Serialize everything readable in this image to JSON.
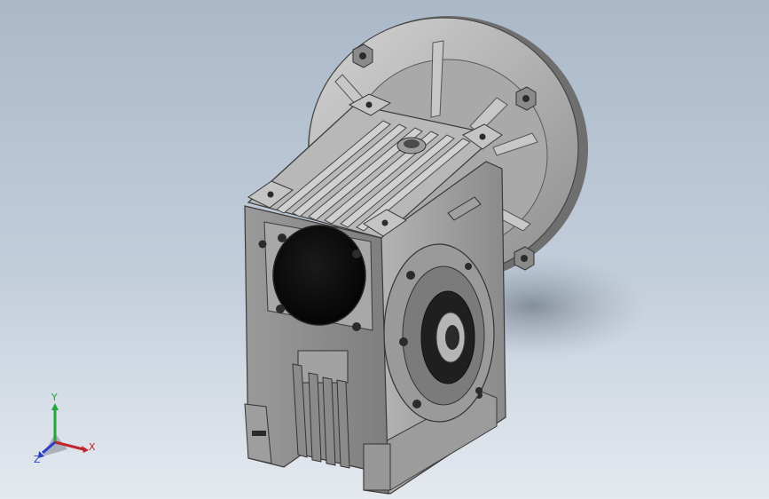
{
  "viewport": {
    "background_top": "#aab8c8",
    "background_bottom": "#e4e9ef"
  },
  "model": {
    "icon": "worm-gearbox-3d-model",
    "shade_light": "#bcbcbc",
    "shade_mid": "#8f8f8f",
    "shade_dark": "#3c3c3c"
  },
  "triad": {
    "icon": "coordinate-triad-icon",
    "x_label": "X",
    "y_label": "Y",
    "z_label": "Z",
    "x_color": "#c0262c",
    "y_color": "#22a53a",
    "z_color": "#2a3ec8"
  }
}
